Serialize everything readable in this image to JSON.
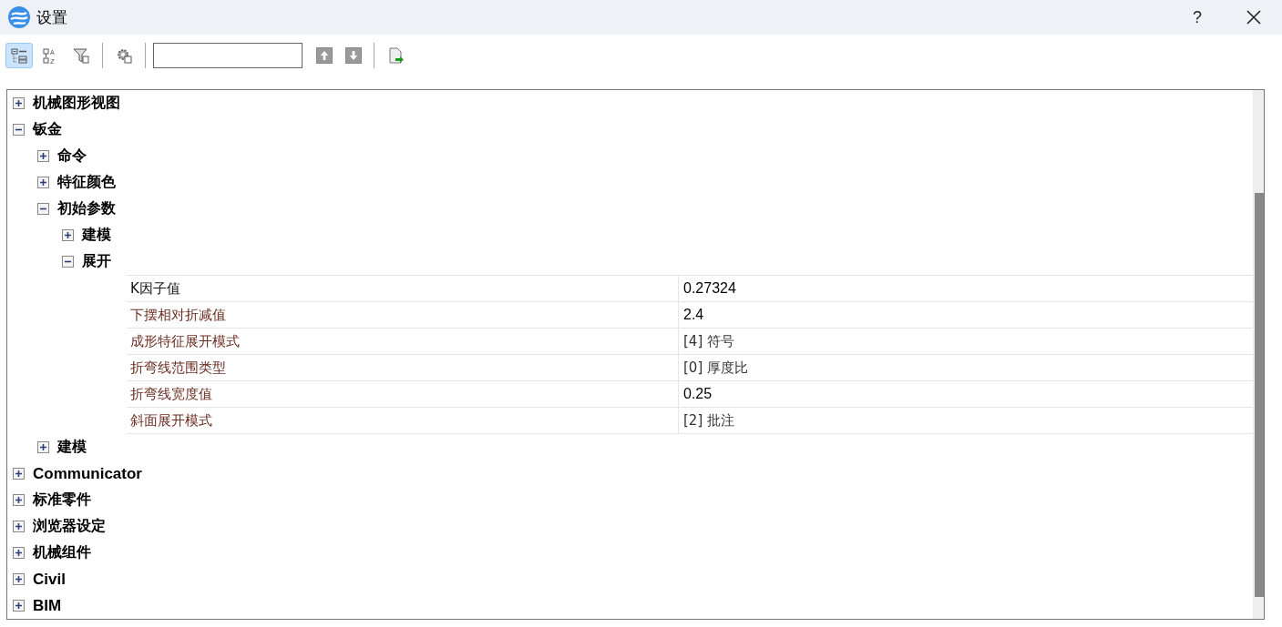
{
  "window": {
    "title": "设置",
    "help": "?"
  },
  "toolbar": {
    "buttons": [
      {
        "kind": "categorized",
        "selected": true
      },
      {
        "kind": "alphabetical",
        "selected": false,
        "letters": [
          "A",
          "Z"
        ]
      },
      {
        "kind": "filter",
        "selected": false
      },
      {
        "kind": "settings",
        "selected": false
      }
    ],
    "nav": [
      {
        "kind": "up"
      },
      {
        "kind": "down"
      }
    ],
    "export": {
      "kind": "export"
    }
  },
  "tree": [
    {
      "label": "机械图形视图",
      "expanded": false
    },
    {
      "label": "钣金",
      "expanded": true,
      "children": [
        {
          "label": "命令",
          "expanded": false
        },
        {
          "label": "特征颜色",
          "expanded": false
        },
        {
          "label": "初始参数",
          "expanded": true,
          "children": [
            {
              "label": "建模",
              "expanded": false
            },
            {
              "label": "展开",
              "expanded": true,
              "properties": [
                {
                  "name": "K因子值",
                  "value": "0.27324",
                  "selected": true,
                  "kind": "number"
                },
                {
                  "name": "下摆相对折减值",
                  "value": "2.4",
                  "selected": false,
                  "kind": "number"
                },
                {
                  "name": "成形特征展开模式",
                  "value": "[4] 符号",
                  "selected": false,
                  "kind": "enum"
                },
                {
                  "name": "折弯线范围类型",
                  "value": "[0] 厚度比",
                  "selected": false,
                  "kind": "enum"
                },
                {
                  "name": "折弯线宽度值",
                  "value": "0.25",
                  "selected": false,
                  "kind": "number"
                },
                {
                  "name": "斜面展开模式",
                  "value": "[2] 批注",
                  "selected": false,
                  "kind": "enum"
                }
              ]
            }
          ]
        },
        {
          "label": "建模",
          "expanded": false
        }
      ]
    },
    {
      "label": "Communicator",
      "expanded": false
    },
    {
      "label": "标准零件",
      "expanded": false
    },
    {
      "label": "浏览器设定",
      "expanded": false
    },
    {
      "label": "机械组件",
      "expanded": false
    },
    {
      "label": "Civil",
      "expanded": false
    },
    {
      "label": "BIM",
      "expanded": false
    }
  ]
}
